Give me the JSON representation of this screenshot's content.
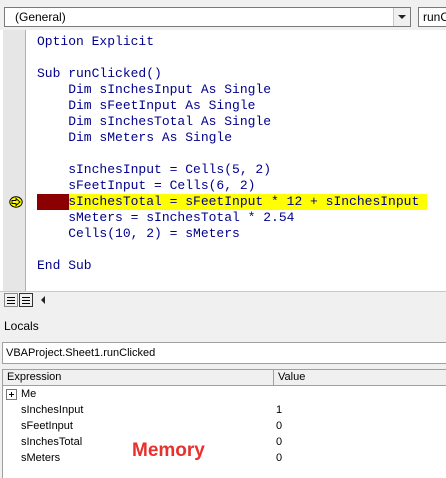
{
  "header": {
    "object_combo": "(General)",
    "procedure_combo": "runC"
  },
  "code": {
    "lines": [
      "Option Explicit",
      "",
      "Sub runClicked()",
      "    Dim sInchesInput As Single",
      "    Dim sFeetInput As Single",
      "    Dim sInchesTotal As Single",
      "    Dim sMeters As Single",
      "",
      "    sInchesInput = Cells(5, 2)",
      "    sFeetInput = Cells(6, 2)",
      "    sInchesTotal = sFeetInput * 12 + sInchesInput",
      "    sMeters = sInchesTotal * 2.54",
      "    Cells(10, 2) = sMeters",
      "",
      "End Sub"
    ],
    "current_line_index": 10
  },
  "locals": {
    "title": "Locals",
    "context": "VBAProject.Sheet1.runClicked",
    "columns": {
      "expression": "Expression",
      "value": "Value"
    },
    "rows": [
      {
        "name": "Me",
        "value": ""
      },
      {
        "name": "sInchesInput",
        "value": "1"
      },
      {
        "name": "sFeetInput",
        "value": "0"
      },
      {
        "name": "sInchesTotal",
        "value": "0"
      },
      {
        "name": "sMeters",
        "value": "0"
      }
    ],
    "annotation": "Memory"
  },
  "colors": {
    "keyword": "#00008b",
    "execution_highlight": "#ffff00",
    "breakpoint": "#8b0000",
    "annotation": "#e8302c"
  }
}
